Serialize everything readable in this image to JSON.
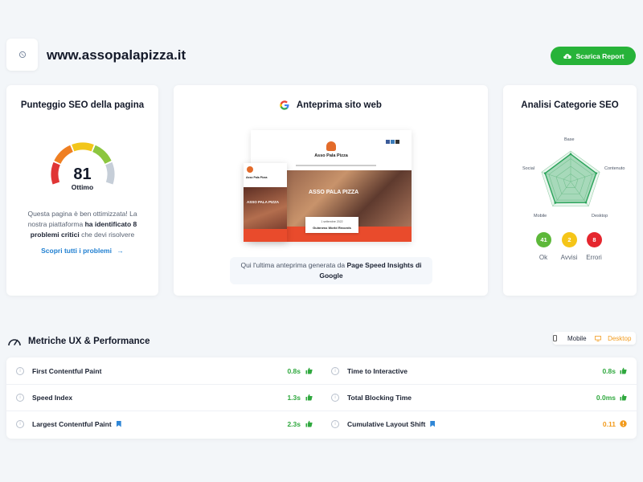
{
  "header": {
    "site_name": "www.assopalapizza.it",
    "download_label": "Scarica Report",
    "download_icon": "cloud-download-icon"
  },
  "seo_card": {
    "title": "Punteggio SEO della pagina",
    "score": "81",
    "score_fraction": 0.81,
    "rating": "Ottimo",
    "desc_plain": "Questa pagina è ben ottimizzata! La nostra piattaforma ",
    "desc_bold": "ha identificato 8 problemi critici",
    "desc_end": " che devi risolvere",
    "link_label": "Scopri tutti i problemi",
    "gauge_colors": [
      "#e03535",
      "#ef7f22",
      "#f2c61b",
      "#8cc63f",
      "#c6ced8"
    ]
  },
  "preview_card": {
    "title": "Anteprima sito web",
    "caption_plain": "Qui l'ultima anteprima generata da ",
    "caption_bold": "Page Speed Insights di Google",
    "mock": {
      "site_title": "Asso Pala Pizza",
      "hero_title": "ASSO PALA PIZZA",
      "card_date": "1 settembre 2022",
      "card_title": "Guinness World Records",
      "mobile_title": "Asso Pala Pizza",
      "mobile_hero": "ASSO PALA PIZZA"
    }
  },
  "categories_card": {
    "title": "Analisi Categorie SEO",
    "axes": [
      "Base",
      "Contenuto",
      "Desktop",
      "Mobile",
      "Social"
    ],
    "ok_count": "41",
    "warn_count": "2",
    "error_count": "8",
    "ok_label": "Ok",
    "warn_label": "Avvisi",
    "error_label": "Errori",
    "colors": {
      "ok": "#5db83a",
      "warn": "#f5c518",
      "error": "#e5262e",
      "radar": "#2aa35a"
    }
  },
  "performance": {
    "title": "Metriche UX & Performance",
    "mode_mobile": "Mobile",
    "mode_desktop": "Desktop",
    "left": [
      {
        "name": "First Contentful Paint",
        "value": "0.8s",
        "status": "good"
      },
      {
        "name": "Speed Index",
        "value": "1.3s",
        "status": "good"
      },
      {
        "name": "Largest Contentful Paint",
        "value": "2.3s",
        "status": "good"
      }
    ],
    "right": [
      {
        "name": "Time to Interactive",
        "value": "0.8s",
        "status": "good"
      },
      {
        "name": "Total Blocking Time",
        "value": "0.0ms",
        "status": "good"
      },
      {
        "name": "Cumulative Layout Shift",
        "value": "0.11",
        "status": "warn"
      }
    ],
    "colors": {
      "good": "#2fa83e",
      "warn": "#f29b1d"
    }
  }
}
